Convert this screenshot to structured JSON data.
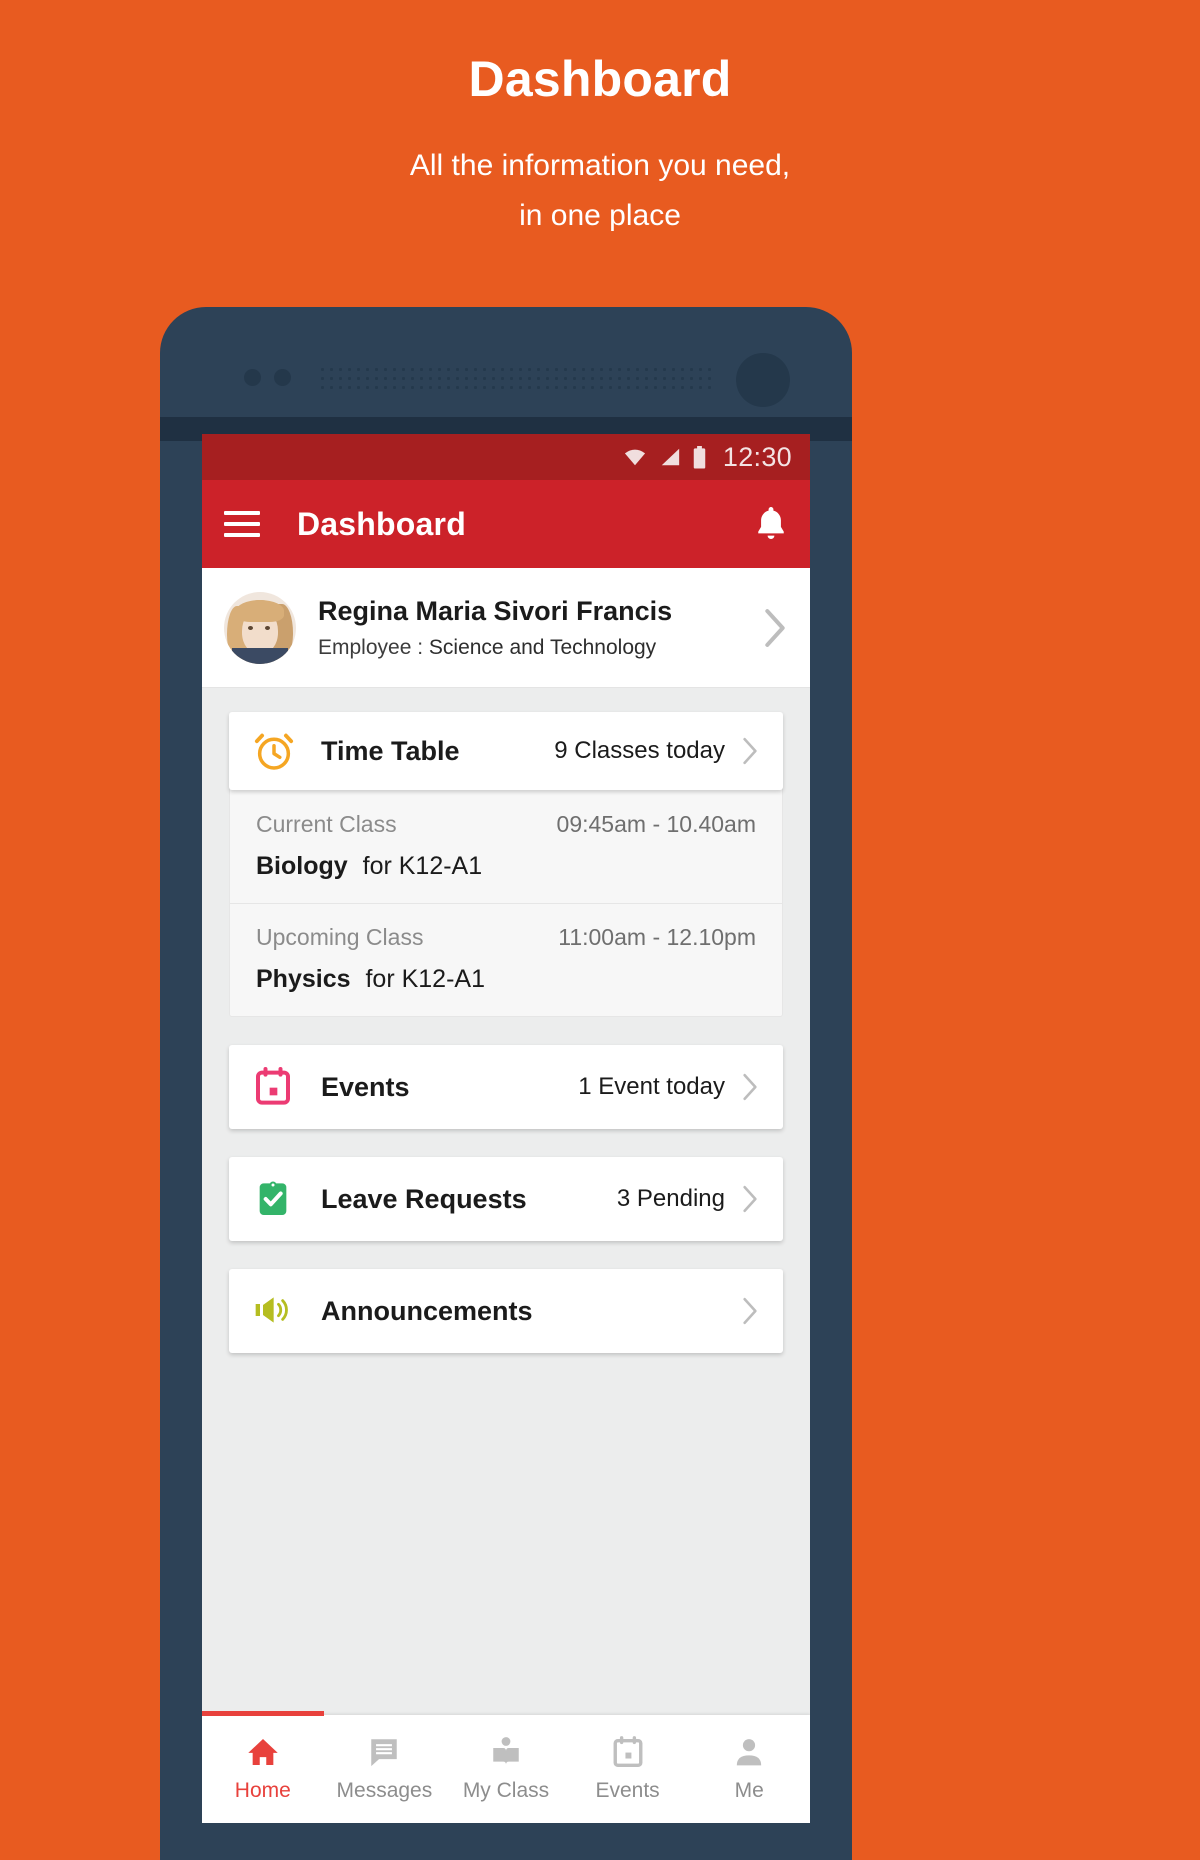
{
  "promo": {
    "title": "Dashboard",
    "subtitle_line1": "All the information you need,",
    "subtitle_line2": "in one place"
  },
  "status_bar": {
    "time": "12:30",
    "wifi_icon": "wifi-icon",
    "signal_icon": "signal-icon",
    "battery_icon": "battery-icon"
  },
  "app_bar": {
    "menu_icon": "hamburger-menu-icon",
    "title": "Dashboard",
    "notification_icon": "bell-icon"
  },
  "profile": {
    "name": "Regina Maria Sivori Francis",
    "role_label": "Employee :",
    "role_value": "Science and Technology",
    "avatar_alt": "avatar",
    "chevron_icon": "chevron-right-icon"
  },
  "cards": {
    "time_table": {
      "icon": "alarm-clock-icon",
      "title": "Time Table",
      "meta": "9 Classes today"
    },
    "events": {
      "icon": "calendar-icon",
      "title": "Events",
      "meta": "1 Event today"
    },
    "leave_requests": {
      "icon": "clipboard-check-icon",
      "title": "Leave Requests",
      "meta": "3 Pending"
    },
    "announcements": {
      "icon": "megaphone-icon",
      "title": "Announcements",
      "meta": ""
    }
  },
  "time_table_detail": [
    {
      "label": "Current Class",
      "time": "09:45am - 10.40am",
      "subject": "Biology",
      "for": "for K12-A1"
    },
    {
      "label": "Upcoming Class",
      "time": "11:00am - 12.10pm",
      "subject": "Physics",
      "for": "for K12-A1"
    }
  ],
  "bottom_nav": {
    "items": [
      {
        "label": "Home",
        "icon": "home-icon",
        "active": true
      },
      {
        "label": "Messages",
        "icon": "message-icon",
        "active": false
      },
      {
        "label": "My Class",
        "icon": "book-person-icon",
        "active": false
      },
      {
        "label": "Events",
        "icon": "calendar-icon",
        "active": false
      },
      {
        "label": "Me",
        "icon": "person-icon",
        "active": false
      }
    ]
  },
  "colors": {
    "background_orange": "#e85b20",
    "phone_body": "#2d4257",
    "status_bar_red": "#a61f20",
    "app_bar_red": "#cc2229",
    "accent_red": "#e8413c",
    "alarm_orange": "#f5a623",
    "calendar_pink": "#ec3b73",
    "clipboard_green": "#33b469",
    "megaphone_olive": "#b5bd21"
  }
}
